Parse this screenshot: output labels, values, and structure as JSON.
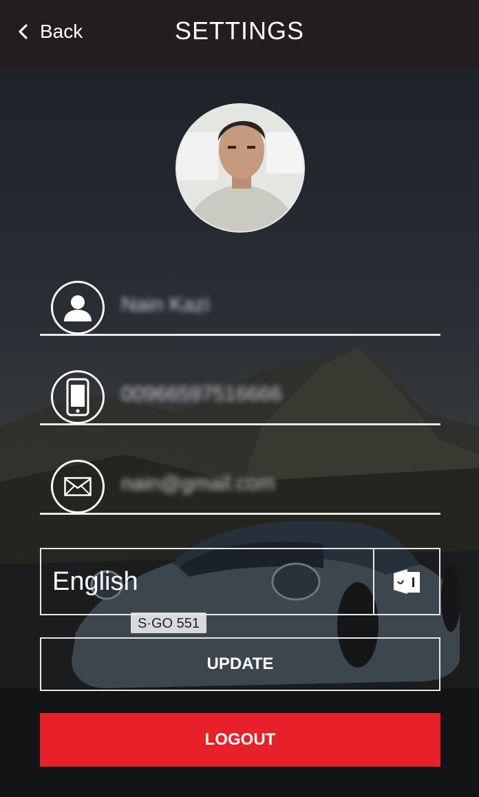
{
  "header": {
    "back_label": "Back",
    "title": "SETTINGS"
  },
  "profile": {
    "name": "Nain Kazi",
    "phone": "00966597516666",
    "email": "nain@gmail.com"
  },
  "language": {
    "selected": "English"
  },
  "actions": {
    "update_label": "UPDATE",
    "logout_label": "LOGOUT"
  },
  "background": {
    "plate_text": "S·GO 551"
  },
  "colors": {
    "header_bg": "#221e1f",
    "logout_red": "#e72029",
    "line": "#e9e9e9"
  },
  "icons": {
    "back": "chevron-left-icon",
    "name": "user-icon",
    "phone": "mobile-phone-icon",
    "email": "envelope-icon",
    "language": "language-icon"
  }
}
